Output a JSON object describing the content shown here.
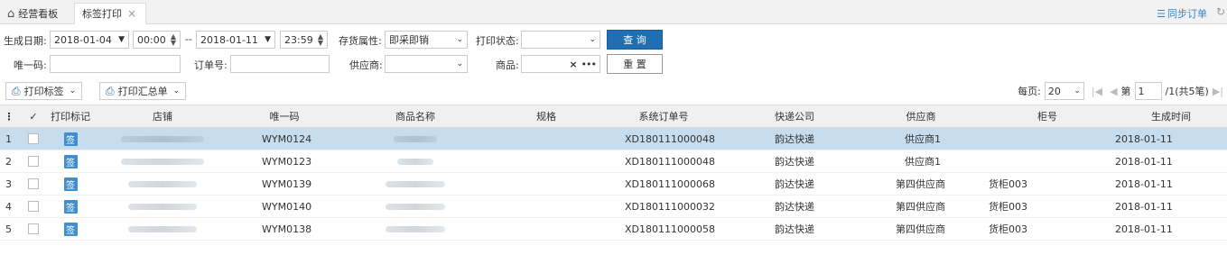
{
  "tabs": {
    "home_label": "经营看板",
    "active_label": "标签打印",
    "close_glyph": "×",
    "sync_label": "同步订单"
  },
  "filters": {
    "gen_date_label": "生成日期:",
    "date_from": "2018-01-04",
    "time_from": "00:00",
    "date_sep": "--",
    "date_to": "2018-01-11",
    "time_to": "23:59",
    "stock_attr_label": "存货属性:",
    "stock_attr_value": "即采即销",
    "print_status_label": "打印状态:",
    "print_status_value": "",
    "query_label": "查 询",
    "unique_code_label": "唯一码:",
    "unique_code_value": "",
    "order_no_label": "订单号:",
    "order_no_value": "",
    "supplier_label": "供应商:",
    "supplier_value": "",
    "product_label": "商品:",
    "product_value": "",
    "reset_label": "重 置"
  },
  "toolbar": {
    "print_label_btn": "打印标签",
    "print_summary_btn": "打印汇总单",
    "per_page_label": "每页:",
    "per_page_value": "20",
    "page_prefix": "第",
    "page_value": "1",
    "page_suffix": "/1(共5笔)"
  },
  "grid": {
    "columns": {
      "check": "✓",
      "print_mark": "打印标记",
      "store": "店铺",
      "unique_code": "唯一码",
      "product_name": "商品名称",
      "spec": "规格",
      "system_order": "系统订单号",
      "courier": "快递公司",
      "supplier": "供应商",
      "cabinet": "柜号",
      "gen_time": "生成时间"
    },
    "sign_glyph": "签",
    "rows": [
      {
        "idx": "1",
        "unique_code": "WYM0124",
        "system_order": "XD180111000048",
        "courier": "韵达快递",
        "supplier": "供应商1",
        "cabinet": "",
        "gen_time": "2018-01-11"
      },
      {
        "idx": "2",
        "unique_code": "WYM0123",
        "system_order": "XD180111000048",
        "courier": "韵达快递",
        "supplier": "供应商1",
        "cabinet": "",
        "gen_time": "2018-01-11"
      },
      {
        "idx": "3",
        "unique_code": "WYM0139",
        "system_order": "XD180111000068",
        "courier": "韵达快递",
        "supplier": "第四供应商",
        "cabinet": "货柜003",
        "gen_time": "2018-01-11"
      },
      {
        "idx": "4",
        "unique_code": "WYM0140",
        "system_order": "XD180111000032",
        "courier": "韵达快递",
        "supplier": "第四供应商",
        "cabinet": "货柜003",
        "gen_time": "2018-01-11"
      },
      {
        "idx": "5",
        "unique_code": "WYM0138",
        "system_order": "XD180111000058",
        "courier": "韵达快递",
        "supplier": "第四供应商",
        "cabinet": "货柜003",
        "gen_time": "2018-01-11"
      }
    ]
  },
  "colors": {
    "accent": "#1f6fb2",
    "selected_row": "#c7dcec",
    "sign_badge": "#3f8fcf"
  },
  "icons": [
    "home-icon",
    "close-icon",
    "sync-icon",
    "spinner-icon",
    "dropdown-caret-icon",
    "clear-icon",
    "more-icon",
    "printer-icon",
    "first-page-icon",
    "prev-page-icon",
    "next-page-icon",
    "last-page-icon"
  ]
}
